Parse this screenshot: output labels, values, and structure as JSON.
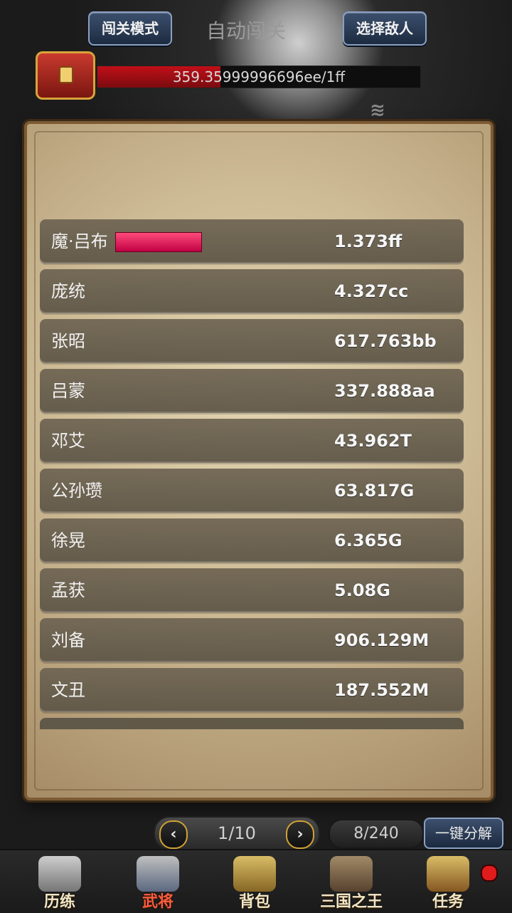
{
  "header": {
    "left_button": "闯关模式",
    "title": "自动闯关",
    "right_button": "选择敌人"
  },
  "boss_hp": {
    "text": "359.35999996696ee/1ff",
    "fill_fraction": 0.38
  },
  "panel": {
    "rows": [
      {
        "name": "魔·吕布",
        "value": "1.373ff",
        "has_bar": true
      },
      {
        "name": "庞统",
        "value": "4.327cc"
      },
      {
        "name": "张昭",
        "value": "617.763bb"
      },
      {
        "name": "吕蒙",
        "value": "337.888aa"
      },
      {
        "name": "邓艾",
        "value": "43.962T"
      },
      {
        "name": "公孙瓒",
        "value": "63.817G"
      },
      {
        "name": "徐晃",
        "value": "6.365G"
      },
      {
        "name": "孟获",
        "value": "5.08G"
      },
      {
        "name": "刘备",
        "value": "906.129M"
      },
      {
        "name": "文丑",
        "value": "187.552M"
      }
    ]
  },
  "pager": {
    "text": "1/10",
    "prev_icon": "chevron-left-icon",
    "next_icon": "chevron-right-icon"
  },
  "inventory": {
    "count": "8/240",
    "decompose_label": "一键分解"
  },
  "bottom_nav": {
    "items": [
      {
        "label": "历练",
        "icon": "warrior-icon",
        "active": false
      },
      {
        "label": "武将",
        "icon": "helmet-icon",
        "active": true
      },
      {
        "label": "背包",
        "icon": "bag-icon",
        "active": false
      },
      {
        "label": "三国之王",
        "icon": "crest-icon",
        "active": false
      },
      {
        "label": "任务",
        "icon": "scroll-icon",
        "active": false
      }
    ]
  }
}
